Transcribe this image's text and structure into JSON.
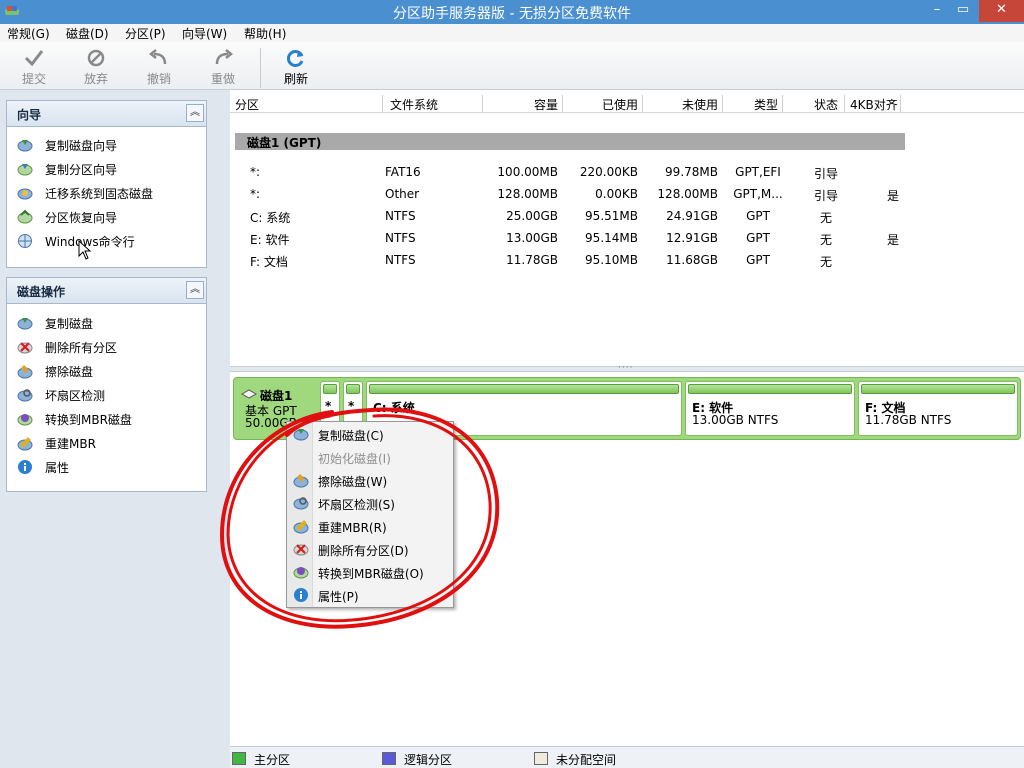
{
  "window": {
    "title": "分区助手服务器版 - 无损分区免费软件",
    "controls": {
      "minimize": "–",
      "maximize": "▭",
      "close": "✕"
    }
  },
  "menu": [
    "常规(G)",
    "磁盘(D)",
    "分区(P)",
    "向导(W)",
    "帮助(H)"
  ],
  "toolbar": {
    "commit": "提交",
    "discard": "放弃",
    "undo": "撤销",
    "redo": "重做",
    "refresh": "刷新"
  },
  "wizard_panel": {
    "title": "向导",
    "items": [
      "复制磁盘向导",
      "复制分区向导",
      "迁移系统到固态磁盘",
      "分区恢复向导",
      "Windows命令行"
    ]
  },
  "disk_ops_panel": {
    "title": "磁盘操作",
    "items": [
      "复制磁盘",
      "删除所有分区",
      "擦除磁盘",
      "坏扇区检测",
      "转换到MBR磁盘",
      "重建MBR",
      "属性"
    ]
  },
  "table": {
    "columns": [
      "分区",
      "文件系统",
      "容量",
      "已使用",
      "未使用",
      "类型",
      "状态",
      "4KB对齐"
    ],
    "disk_title": "磁盘1 (GPT)",
    "rows": [
      {
        "partition": "*:",
        "fs": "FAT16",
        "capacity": "100.00MB",
        "used": "220.00KB",
        "unused": "99.78MB",
        "type": "GPT,EFI",
        "status": "引导",
        "align": ""
      },
      {
        "partition": "*:",
        "fs": "Other",
        "capacity": "128.00MB",
        "used": "0.00KB",
        "unused": "128.00MB",
        "type": "GPT,M...",
        "status": "引导",
        "align": "是"
      },
      {
        "partition": "C: 系统",
        "fs": "NTFS",
        "capacity": "25.00GB",
        "used": "95.51MB",
        "unused": "24.91GB",
        "type": "GPT",
        "status": "无",
        "align": ""
      },
      {
        "partition": "E: 软件",
        "fs": "NTFS",
        "capacity": "13.00GB",
        "used": "95.14MB",
        "unused": "12.91GB",
        "type": "GPT",
        "status": "无",
        "align": "是"
      },
      {
        "partition": "F: 文档",
        "fs": "NTFS",
        "capacity": "11.78GB",
        "used": "95.10MB",
        "unused": "11.68GB",
        "type": "GPT",
        "status": "无",
        "align": ""
      }
    ]
  },
  "disk_map": {
    "disk_name": "磁盘1",
    "disk_type": "基本 GPT",
    "disk_size": "50.00GB",
    "partitions": [
      {
        "name": "*",
        "info": ""
      },
      {
        "name": "*",
        "info": ""
      },
      {
        "name": "C: 系统",
        "info": ""
      },
      {
        "name": "E: 软件",
        "info": "13.00GB NTFS"
      },
      {
        "name": "F: 文档",
        "info": "11.78GB NTFS"
      }
    ]
  },
  "context_menu": {
    "items": [
      {
        "label": "复制磁盘(C)",
        "enabled": true,
        "icon": "copy-disk-icon"
      },
      {
        "label": "初始化磁盘(I)",
        "enabled": false,
        "icon": ""
      },
      {
        "label": "擦除磁盘(W)",
        "enabled": true,
        "icon": "wipe-disk-icon"
      },
      {
        "label": "坏扇区检测(S)",
        "enabled": true,
        "icon": "bad-sector-icon"
      },
      {
        "label": "重建MBR(R)",
        "enabled": true,
        "icon": "rebuild-mbr-icon"
      },
      {
        "label": "删除所有分区(D)",
        "enabled": true,
        "icon": "delete-partitions-icon"
      },
      {
        "label": "转换到MBR磁盘(O)",
        "enabled": true,
        "icon": "convert-mbr-icon"
      },
      {
        "label": "属性(P)",
        "enabled": true,
        "icon": "info-icon"
      }
    ]
  },
  "legend": {
    "primary": "主分区",
    "logical": "逻辑分区",
    "unallocated": "未分配空间"
  },
  "colors": {
    "titlebar": "#4a8fd0",
    "close_button": "#c7463a",
    "primary_partition": "#42b843",
    "logical_partition": "#5a5ad8",
    "unallocated": "#f0ebe0",
    "annotation": "#e01010"
  }
}
